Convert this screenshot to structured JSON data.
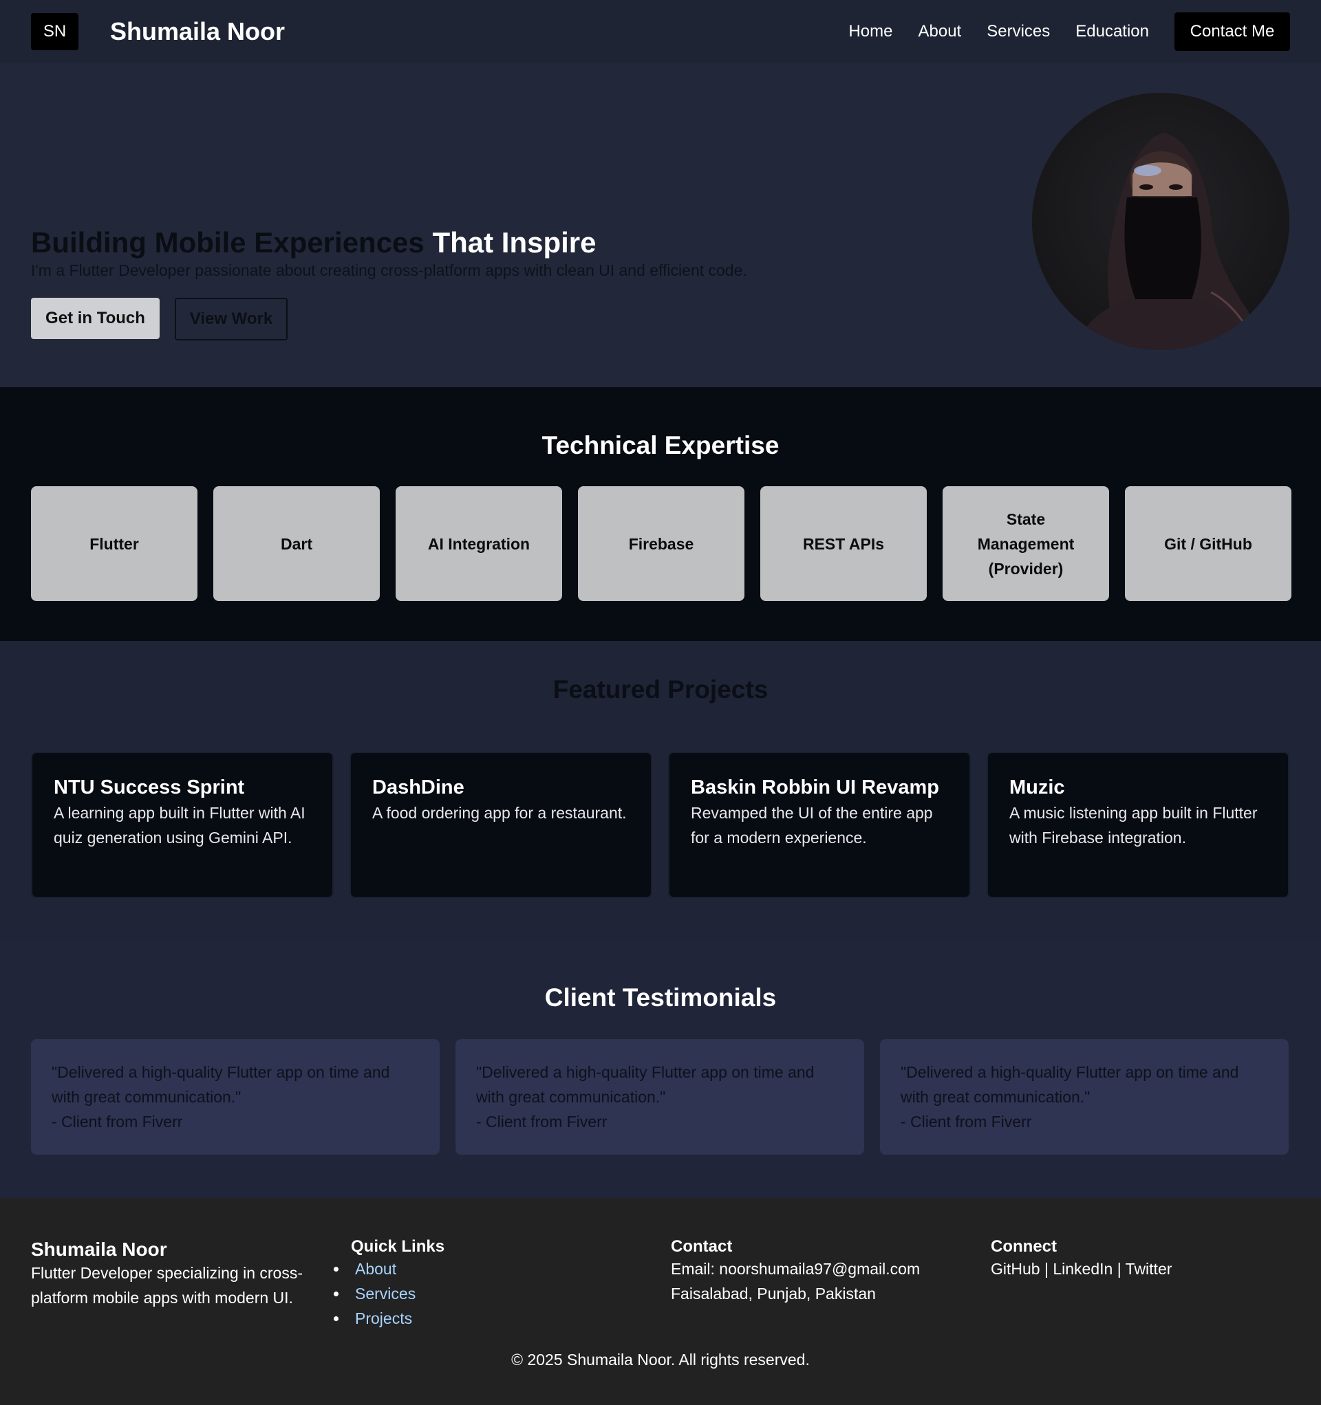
{
  "nav": {
    "logo": "SN",
    "brand": "Shumaila Noor",
    "links": [
      "Home",
      "About",
      "Services",
      "Education"
    ],
    "contact_label": "Contact Me"
  },
  "hero": {
    "title_dark": "Building Mobile Experiences",
    "title_light": "That Inspire",
    "subtitle": "I'm a Flutter Developer passionate about creating cross-platform apps with clean UI and efficient code.",
    "primary_button": "Get in Touch",
    "secondary_button": "View Work"
  },
  "skills": {
    "title": "Technical Expertise",
    "items": [
      "Flutter",
      "Dart",
      "AI Integration",
      "Firebase",
      "REST APIs",
      "State Management (Provider)",
      "Git / GitHub"
    ]
  },
  "projects": {
    "title": "Featured Projects",
    "items": [
      {
        "title": "NTU Success Sprint",
        "desc": "A learning app built in Flutter with AI quiz generation using Gemini API."
      },
      {
        "title": "DashDine",
        "desc": "A food ordering app for a restaurant."
      },
      {
        "title": "Baskin Robbin UI Revamp",
        "desc": "Revamped the UI of the entire app for a modern experience."
      },
      {
        "title": "Muzic",
        "desc": "A music listening app built in Flutter with Firebase integration."
      }
    ]
  },
  "testimonials": {
    "title": "Client Testimonials",
    "items": [
      {
        "quote": "\"Delivered a high-quality Flutter app on time and with great communication.\"",
        "author": "- Client from Fiverr"
      },
      {
        "quote": "\"Delivered a high-quality Flutter app on time and with great communication.\"",
        "author": "- Client from Fiverr"
      },
      {
        "quote": "\"Delivered a high-quality Flutter app on time and with great communication.\"",
        "author": "- Client from Fiverr"
      }
    ]
  },
  "footer": {
    "brand": "Shumaila Noor",
    "tagline": "Flutter Developer specializing in cross-platform mobile apps with modern UI.",
    "quick_links_title": "Quick Links",
    "quick_links": [
      "About",
      "Services",
      "Projects"
    ],
    "contact_title": "Contact",
    "email": "Email: noorshumaila97@gmail.com",
    "location": "Faisalabad, Punjab, Pakistan",
    "connect_title": "Connect",
    "social": [
      "GitHub",
      "LinkedIn",
      "Twitter"
    ],
    "separator": " | ",
    "copyright": "© 2025 Shumaila Noor. All rights reserved."
  }
}
